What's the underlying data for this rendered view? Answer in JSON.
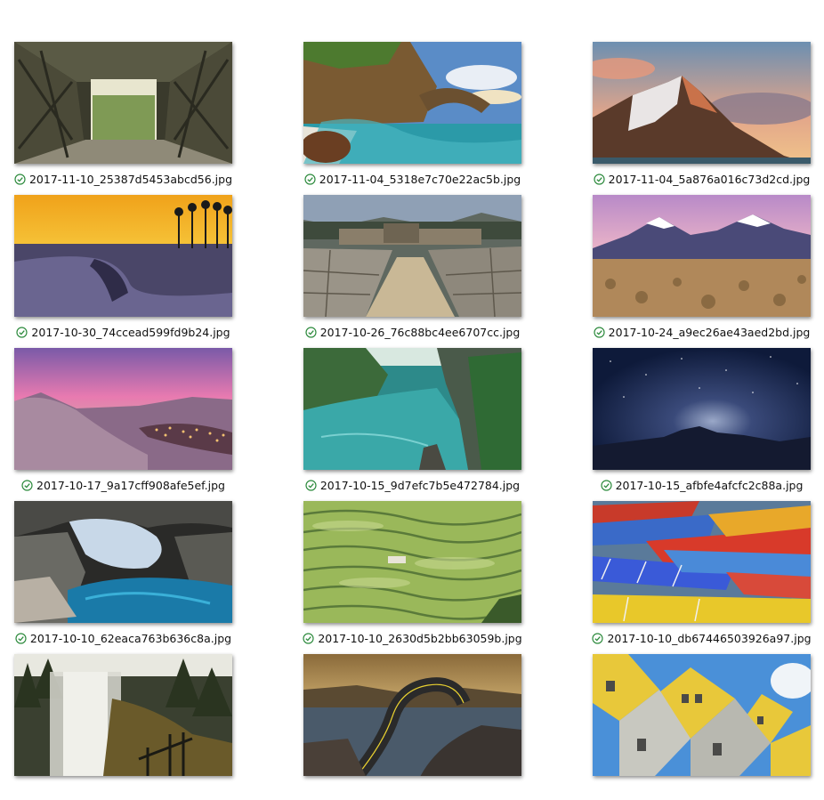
{
  "colors": {
    "sync_check": "#2e8b3e"
  },
  "items": [
    {
      "filename": "2017-11-10_25387d5453abcd56.jpg",
      "status_icon": "synced-check-icon"
    },
    {
      "filename": "2017-11-04_5318e7c70e22ac5b.jpg",
      "status_icon": "synced-check-icon"
    },
    {
      "filename": "2017-11-04_5a876a016c73d2cd.jpg",
      "status_icon": "synced-check-icon"
    },
    {
      "filename": "2017-10-30_74ccead599fd9b24.jpg",
      "status_icon": "synced-check-icon"
    },
    {
      "filename": "2017-10-26_76c88bc4ee6707cc.jpg",
      "status_icon": "synced-check-icon"
    },
    {
      "filename": "2017-10-24_a9ec26ae43aed2bd.jpg",
      "status_icon": "synced-check-icon"
    },
    {
      "filename": "2017-10-17_9a17cff908afe5ef.jpg",
      "status_icon": "synced-check-icon"
    },
    {
      "filename": "2017-10-15_9d7efc7b5e472784.jpg",
      "status_icon": "synced-check-icon"
    },
    {
      "filename": "2017-10-15_afbfe4afcfc2c88a.jpg",
      "status_icon": "synced-check-icon"
    },
    {
      "filename": "2017-10-10_62eaca763b636c8a.jpg",
      "status_icon": "synced-check-icon"
    },
    {
      "filename": "2017-10-10_2630d5b2bb63059b.jpg",
      "status_icon": "synced-check-icon"
    },
    {
      "filename": "2017-10-10_db67446503926a97.jpg",
      "status_icon": "synced-check-icon"
    },
    {
      "filename": "",
      "status_icon": ""
    },
    {
      "filename": "",
      "status_icon": ""
    },
    {
      "filename": "",
      "status_icon": ""
    }
  ]
}
